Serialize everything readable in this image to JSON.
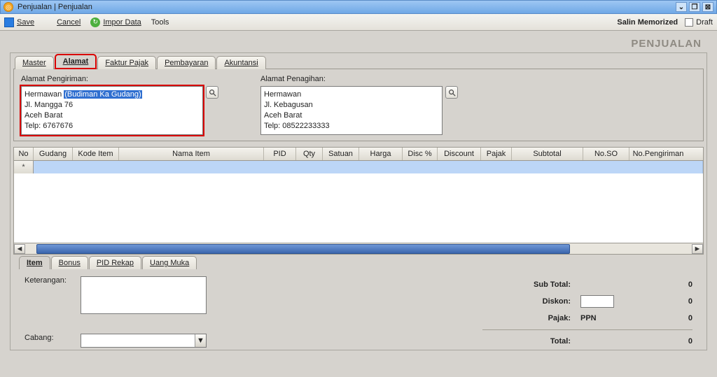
{
  "window": {
    "title": "Penjualan | Penjualan"
  },
  "toolbar": {
    "save": "Save",
    "cancel": "Cancel",
    "impor": "Impor Data",
    "tools": "Tools",
    "salin": "Salin Memorized",
    "draft": "Draft"
  },
  "header": {
    "title": "PENJUALAN"
  },
  "tabs_top": [
    "Master",
    "Alamat",
    "Faktur Pajak",
    "Pembayaran",
    "Akuntansi"
  ],
  "alamat": {
    "pengiriman_label": "Alamat Pengiriman:",
    "penagihan_label": "Alamat Penagihan:",
    "pengiriman": {
      "l1a": "Hermawan ",
      "l1b": "(Budiman Ka Gudang)",
      "l2": "Jl. Mangga 76",
      "l3": "Aceh Barat",
      "l4": "Telp: 6767676"
    },
    "penagihan": {
      "l1": "Hermawan",
      "l2": "Jl. Kebagusan",
      "l3": "Aceh Barat",
      "l4": "Telp: 08522233333"
    }
  },
  "grid_headers": [
    "No",
    "Gudang",
    "Kode Item",
    "Nama Item",
    "PID",
    "Qty",
    "Satuan",
    "Harga",
    "Disc %",
    "Discount",
    "Pajak",
    "Subtotal",
    "No.SO",
    "No.Pengiriman"
  ],
  "tabs_bottom": [
    "Item",
    "Bonus",
    "PID Rekap",
    "Uang Muka"
  ],
  "form": {
    "keterangan": "Keterangan:",
    "cabang": "Cabang:"
  },
  "totals": {
    "sub": "Sub Total:",
    "diskon": "Diskon:",
    "pajak": "Pajak:",
    "ppn": "PPN",
    "total": "Total:",
    "v_sub": "0",
    "v_diskon": "0",
    "v_pajak": "0",
    "v_total": "0"
  }
}
